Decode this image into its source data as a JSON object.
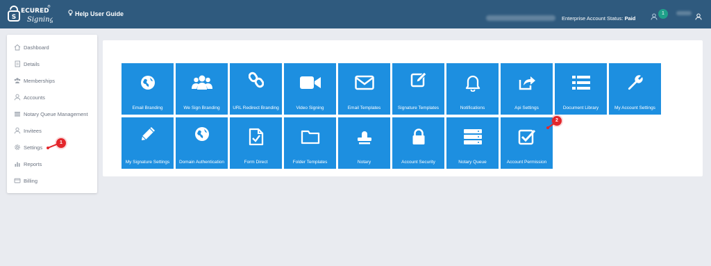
{
  "header": {
    "logo_text_top": "ECURED",
    "logo_text_bottom": "Signing",
    "logo_mark": "®",
    "help_label": "Help User Guide",
    "status_label": "Enterprise Account Status:",
    "status_value": "Paid",
    "notification_count": "1"
  },
  "sidebar": {
    "items": [
      {
        "label": "Dashboard",
        "icon": "home-icon"
      },
      {
        "label": "Details",
        "icon": "document-icon"
      },
      {
        "label": "Memberships",
        "icon": "users-icon"
      },
      {
        "label": "Accounts",
        "icon": "user-icon"
      },
      {
        "label": "Notary Queue Management",
        "icon": "list-icon"
      },
      {
        "label": "Invitees",
        "icon": "user-icon"
      },
      {
        "label": "Settings",
        "icon": "gear-icon"
      },
      {
        "label": "Reports",
        "icon": "bar-chart-icon"
      },
      {
        "label": "Billing",
        "icon": "card-icon"
      }
    ]
  },
  "tiles": [
    {
      "label": "Email Branding",
      "icon": "globe-icon"
    },
    {
      "label": "We Sign Branding",
      "icon": "users-icon"
    },
    {
      "label": "URL Redirect Branding",
      "icon": "link-icon"
    },
    {
      "label": "Video Signing",
      "icon": "video-camera-icon"
    },
    {
      "label": "Email Templates",
      "icon": "envelope-icon"
    },
    {
      "label": "Signature Templates",
      "icon": "edit-icon"
    },
    {
      "label": "Notifications",
      "icon": "bell-icon"
    },
    {
      "label": "Api Settings",
      "icon": "share-icon"
    },
    {
      "label": "Document Library",
      "icon": "list-icon"
    },
    {
      "label": "My Account Settings",
      "icon": "wrench-icon"
    },
    {
      "label": "My Signature Settings",
      "icon": "pencil-icon"
    },
    {
      "label": "Domain Authentication",
      "icon": "globe-icon"
    },
    {
      "label": "Form Direct",
      "icon": "file-check-icon"
    },
    {
      "label": "Folder Templates",
      "icon": "folder-icon"
    },
    {
      "label": "Notary",
      "icon": "stamp-icon"
    },
    {
      "label": "Account Security",
      "icon": "lock-icon"
    },
    {
      "label": "Notary Queue",
      "icon": "server-icon"
    },
    {
      "label": "Account Permission",
      "icon": "checkbox-icon"
    }
  ],
  "markers": [
    "1",
    "2"
  ],
  "colors": {
    "header": "#2f5a7e",
    "tile": "#1d8fe0",
    "marker": "#e3262b",
    "badge": "#1fa08a"
  }
}
